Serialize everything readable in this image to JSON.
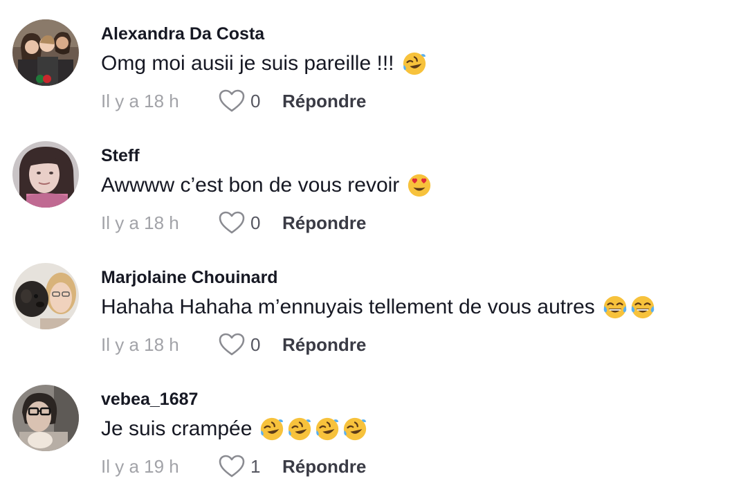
{
  "comments": [
    {
      "username": "Alexandra Da Costa",
      "text": "Omg moi ausii je suis pareille !!!",
      "emojis": [
        "rolling-laughing-emoji"
      ],
      "time": "Il y a 18 h",
      "likes": "0",
      "reply": "Répondre"
    },
    {
      "username": "Steff",
      "text": "Awwww c’est bon de vous revoir",
      "emojis": [
        "heart-eyes-emoji"
      ],
      "time": "Il y a 18 h",
      "likes": "0",
      "reply": "Répondre"
    },
    {
      "username": "Marjolaine Chouinard",
      "text": "Hahaha Hahaha m’ennuyais tellement de vous autres",
      "emojis": [
        "tears-of-joy-emoji",
        "tears-of-joy-emoji"
      ],
      "time": "Il y a 18 h",
      "likes": "0",
      "reply": "Répondre"
    },
    {
      "username": "vebea_1687",
      "text": "Je suis crampée",
      "emojis": [
        "rolling-laughing-emoji",
        "rolling-laughing-emoji",
        "rolling-laughing-emoji",
        "rolling-laughing-emoji"
      ],
      "time": "Il y a 19 h",
      "likes": "1",
      "reply": "Répondre"
    }
  ]
}
